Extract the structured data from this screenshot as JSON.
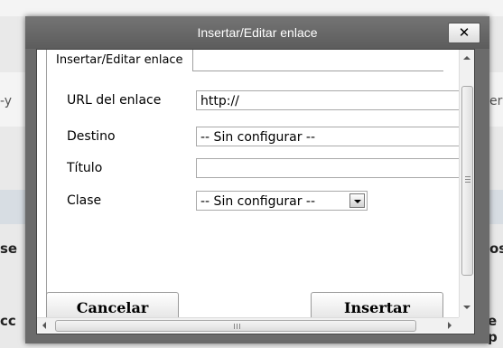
{
  "background": {
    "fragments": [
      "-y",
      "er",
      "se",
      "os",
      "cc",
      "e p"
    ]
  },
  "dialog": {
    "title": "Insertar/Editar enlace",
    "close_label": "✕",
    "tab_label": "Insertar/Editar enlace",
    "fields": {
      "url_label": "URL del enlace",
      "url_value": "http://",
      "target_label": "Destino",
      "target_value": "-- Sin configurar --",
      "title_label": "Título",
      "title_value": "",
      "class_label": "Clase",
      "class_value": "-- Sin configurar --"
    },
    "buttons": {
      "cancel": "Cancelar",
      "insert": "Insertar"
    },
    "scroll_grip": "≡",
    "hscroll_grip": "|||"
  },
  "colors": {
    "titlebar": "#5c5c5c",
    "overlay": "#6b6b6b"
  }
}
